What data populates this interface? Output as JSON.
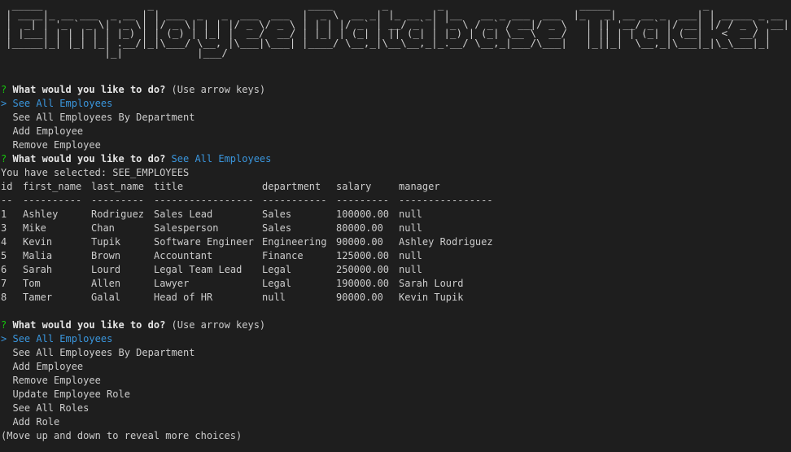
{
  "banner": {
    "text": " _____                 _                         ____        _        _                      _____               _             \n| ____|_ __ ___  _ __ | | ___  _   _  ___  ___  |  _ \\  __ _| |_ __ _| |__   __ _ ___  ___  |_   _| __ __ _  ___| | _____ _ __ \n|  _| | '_ ` _ \\| '_ \\| |/ _ \\| | | |/ _ \\/ _ \\ | | | |/ _` | __/ _` | '_ \\ / _` / __|/ _ \\   | || '__/ _` |/ __| |/ / _ \\ '__|\n| |___| | | | | | |_) | | (_) | |_| |  __/  __/ | |_| | (_| | || (_| | |_) | (_| \\__ \\  __/   | || | | (_| | (__|   <  __/ |   \n|_____|_| |_| |_| .__/|_|\\___/ \\__, |\\___|\\___| |____/ \\__,_|\\__\\__,_|_.__/ \\__,_|___/\\___|   |_||_|  \\__,_|\\___|_|\\_\\___|_|   \n                |_|            |___/                                                                                             "
  },
  "prompt1": {
    "marker": "?",
    "question": "What would you like to do?",
    "hint": "(Use arrow keys)",
    "pointer": ">",
    "options": [
      "See All Employees",
      "See All Employees By Department",
      "Add Employee",
      "Remove Employee"
    ]
  },
  "answered": {
    "marker": "?",
    "question": "What would you like to do?",
    "answer": "See All Employees"
  },
  "selected_message": "You have selected: SEE_EMPLOYEES",
  "table": {
    "headers": [
      "id",
      "first_name",
      "last_name",
      "title",
      "department",
      "salary",
      "manager"
    ],
    "separators": [
      "--",
      "----------",
      "---------",
      "-----------------",
      "-----------",
      "---------",
      "----------------"
    ],
    "rows": [
      [
        "1",
        "Ashley",
        "Rodriguez",
        "Sales Lead",
        "Sales",
        "100000.00",
        "null"
      ],
      [
        "3",
        "Mike",
        "Chan",
        "Salesperson",
        "Sales",
        "80000.00",
        "null"
      ],
      [
        "4",
        "Kevin",
        "Tupik",
        "Software Engineer",
        "Engineering",
        "90000.00",
        "Ashley Rodriguez"
      ],
      [
        "5",
        "Malia",
        "Brown",
        "Accountant",
        "Finance",
        "125000.00",
        "null"
      ],
      [
        "6",
        "Sarah",
        "Lourd",
        "Legal Team Lead",
        "Legal",
        "250000.00",
        "null"
      ],
      [
        "7",
        "Tom",
        "Allen",
        "Lawyer",
        "Legal",
        "190000.00",
        "Sarah Lourd"
      ],
      [
        "8",
        "Tamer",
        "Galal",
        "Head of HR",
        "null",
        "90000.00",
        "Kevin Tupik"
      ]
    ]
  },
  "prompt2": {
    "marker": "?",
    "question": "What would you like to do?",
    "hint": "(Use arrow keys)",
    "pointer": ">",
    "options": [
      "See All Employees",
      "See All Employees By Department",
      "Add Employee",
      "Remove Employee",
      "Update Employee Role",
      "See All Roles",
      "Add Role"
    ],
    "footer": "(Move up and down to reveal more choices)"
  },
  "colors": {
    "background": "#1e1e1e",
    "text": "#cccccc",
    "question_mark": "#16c60c",
    "highlight": "#3a96dd"
  }
}
